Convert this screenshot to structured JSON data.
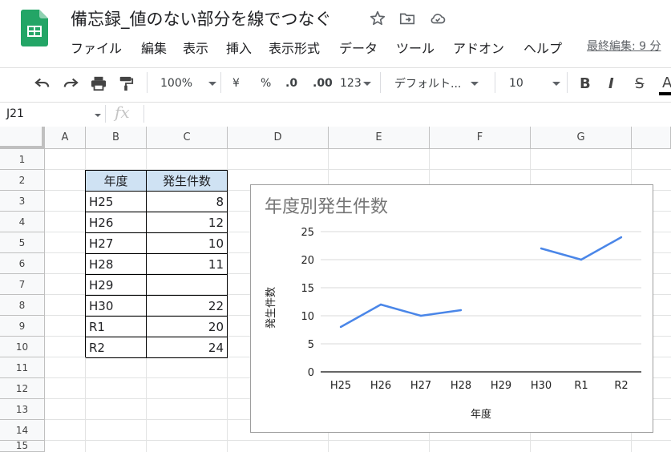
{
  "app": {
    "icon": "sheets-logo-icon"
  },
  "doc": {
    "title": "備忘録_値のない部分を線でつなぐ"
  },
  "menu": [
    "ファイル",
    "編集",
    "表示",
    "挿入",
    "表示形式",
    "データ",
    "ツール",
    "アドオン",
    "ヘルプ"
  ],
  "last_edit": "最終編集: 9 分",
  "toolbar": {
    "zoom": "100%",
    "currency": "¥",
    "percent": "%",
    "dec_decrease": ".0",
    "dec_increase": ".00",
    "number_format": "123",
    "font": "デフォルト...",
    "font_size": "10",
    "bold": "B",
    "italic": "I",
    "strike": "S",
    "text_color": "A"
  },
  "formula_bar": {
    "name_box": "J21",
    "fx": "fx"
  },
  "columns": [
    "A",
    "B",
    "C",
    "D",
    "E",
    "F",
    "G"
  ],
  "rows": [
    "1",
    "2",
    "3",
    "4",
    "5",
    "6",
    "7",
    "8",
    "9",
    "10",
    "11",
    "12",
    "13",
    "14",
    "15"
  ],
  "table": {
    "headers": [
      "年度",
      "発生件数"
    ],
    "rows": [
      [
        "H25",
        "8"
      ],
      [
        "H26",
        "12"
      ],
      [
        "H27",
        "10"
      ],
      [
        "H28",
        "11"
      ],
      [
        "H29",
        ""
      ],
      [
        "H30",
        "22"
      ],
      [
        "R1",
        "20"
      ],
      [
        "R2",
        "24"
      ]
    ]
  },
  "chart_data": {
    "type": "line",
    "title": "年度別発生件数",
    "xlabel": "年度",
    "ylabel": "発生件数",
    "categories": [
      "H25",
      "H26",
      "H27",
      "H28",
      "H29",
      "H30",
      "R1",
      "R2"
    ],
    "series": [
      {
        "values": [
          8,
          12,
          10,
          11,
          null,
          22,
          20,
          24
        ],
        "color": "#4a86e8"
      }
    ],
    "yticks": [
      0,
      5,
      10,
      15,
      20,
      25
    ],
    "ylim": [
      0,
      25
    ],
    "grid": true,
    "legend": "none"
  }
}
